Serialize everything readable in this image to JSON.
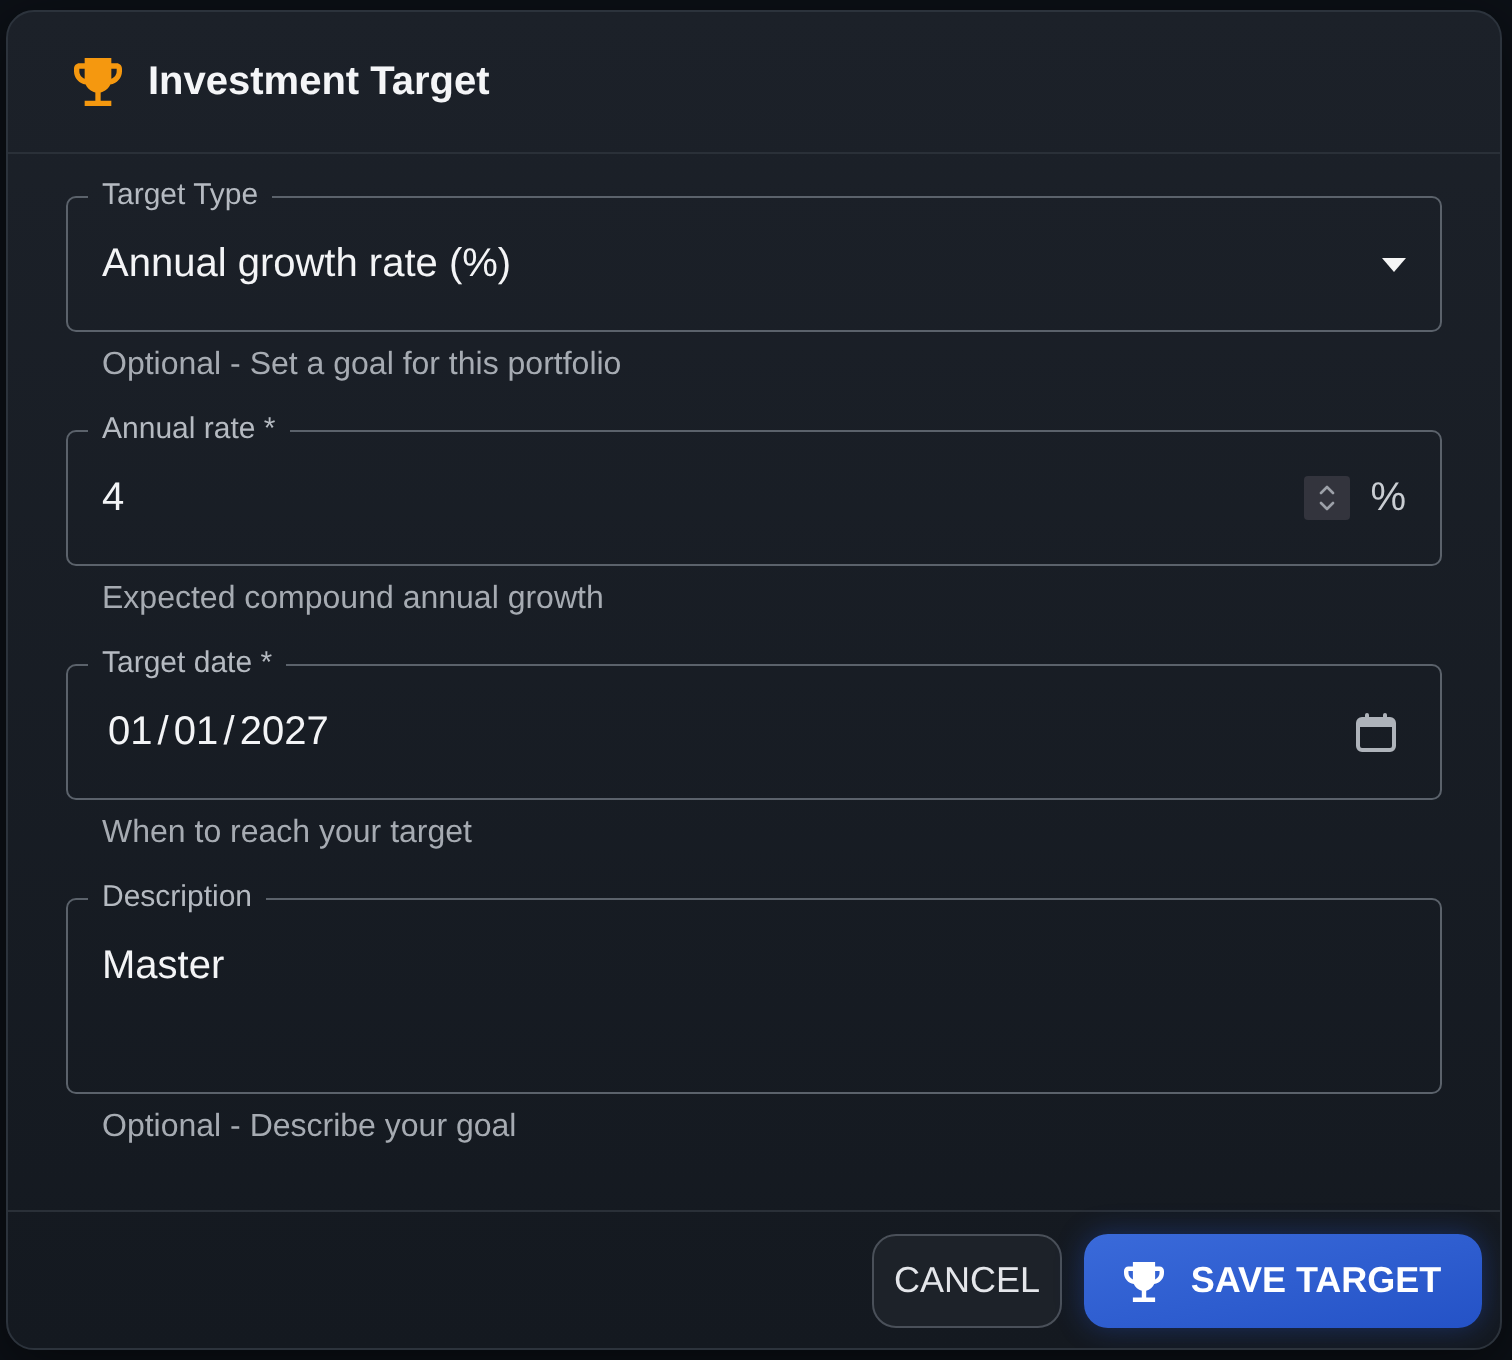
{
  "dialog": {
    "title": "Investment Target"
  },
  "fields": [
    {
      "kind": "select",
      "label": "Target Type",
      "value": "Annual growth rate (%)",
      "helper": "Optional - Set a goal for this portfolio"
    },
    {
      "kind": "number",
      "label": "Annual rate *",
      "value": "4",
      "suffix": "%",
      "helper": "Expected compound annual growth"
    },
    {
      "kind": "date",
      "label": "Target date *",
      "value": "01 / 01 / 2027",
      "helper": "When to reach your target"
    },
    {
      "kind": "textarea",
      "label": "Description",
      "value": "Master",
      "helper": "Optional - Describe your goal"
    }
  ],
  "buttons": [
    {
      "kind": "outlined",
      "label": "CANCEL"
    },
    {
      "kind": "primary",
      "label": "SAVE TARGET"
    }
  ]
}
